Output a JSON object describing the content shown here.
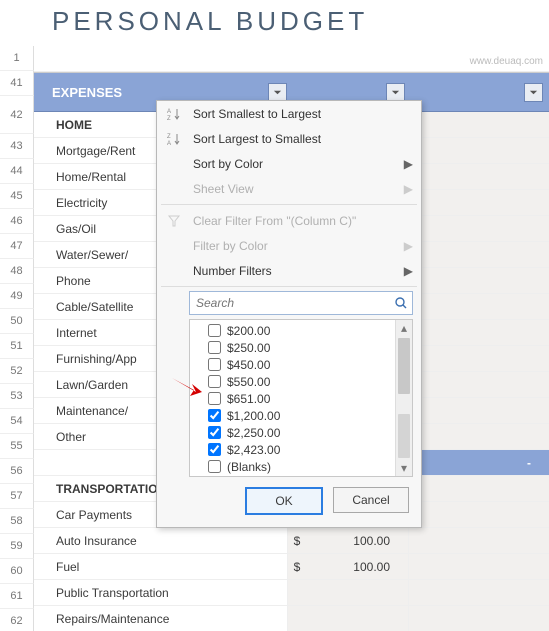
{
  "title": "PERSONAL BUDGET",
  "watermark": "www.deuaq.com",
  "header": {
    "label": "EXPENSES"
  },
  "row_numbers": [
    "1",
    "41",
    "42",
    "43",
    "44",
    "45",
    "46",
    "47",
    "48",
    "49",
    "50",
    "51",
    "52",
    "53",
    "54",
    "55",
    "56",
    "57",
    "58",
    "59",
    "60",
    "61",
    "62"
  ],
  "rows": [
    {
      "label": "HOME",
      "bold": true
    },
    {
      "label": "Mortgage/Rent"
    },
    {
      "label": "Home/Rental"
    },
    {
      "label": "Electricity"
    },
    {
      "label": "Gas/Oil"
    },
    {
      "label": "Water/Sewer/"
    },
    {
      "label": "Phone"
    },
    {
      "label": "Cable/Satellite"
    },
    {
      "label": "Internet"
    },
    {
      "label": "Furnishing/App"
    },
    {
      "label": "Lawn/Garden"
    },
    {
      "label": "Maintenance/"
    },
    {
      "label": "Other"
    },
    {
      "label": "",
      "totalB": true,
      "cur": "$",
      "val": "-"
    },
    {
      "label": "TRANSPORTATION",
      "bold": true
    },
    {
      "label": "Car Payments"
    },
    {
      "label": "Auto Insurance",
      "cur": "$",
      "val": "100.00"
    },
    {
      "label": "Fuel",
      "cur": "$",
      "val": "100.00"
    },
    {
      "label": "Public Transportation"
    },
    {
      "label": "Repairs/Maintenance"
    }
  ],
  "menu": {
    "sort_asc": "Sort Smallest to Largest",
    "sort_desc": "Sort Largest to Smallest",
    "sort_color": "Sort by Color",
    "sheet_view": "Sheet View",
    "clear": "Clear Filter From \"(Column C)\"",
    "filter_color": "Filter by Color",
    "number_filters": "Number Filters",
    "search_placeholder": "Search",
    "items": [
      {
        "label": "$200.00",
        "checked": false
      },
      {
        "label": "$250.00",
        "checked": false
      },
      {
        "label": "$450.00",
        "checked": false
      },
      {
        "label": "$550.00",
        "checked": false
      },
      {
        "label": "$651.00",
        "checked": false
      },
      {
        "label": "$1,200.00",
        "checked": true
      },
      {
        "label": "$2,250.00",
        "checked": true
      },
      {
        "label": "$2,423.00",
        "checked": true
      },
      {
        "label": "(Blanks)",
        "checked": false
      }
    ],
    "ok": "OK",
    "cancel": "Cancel"
  }
}
